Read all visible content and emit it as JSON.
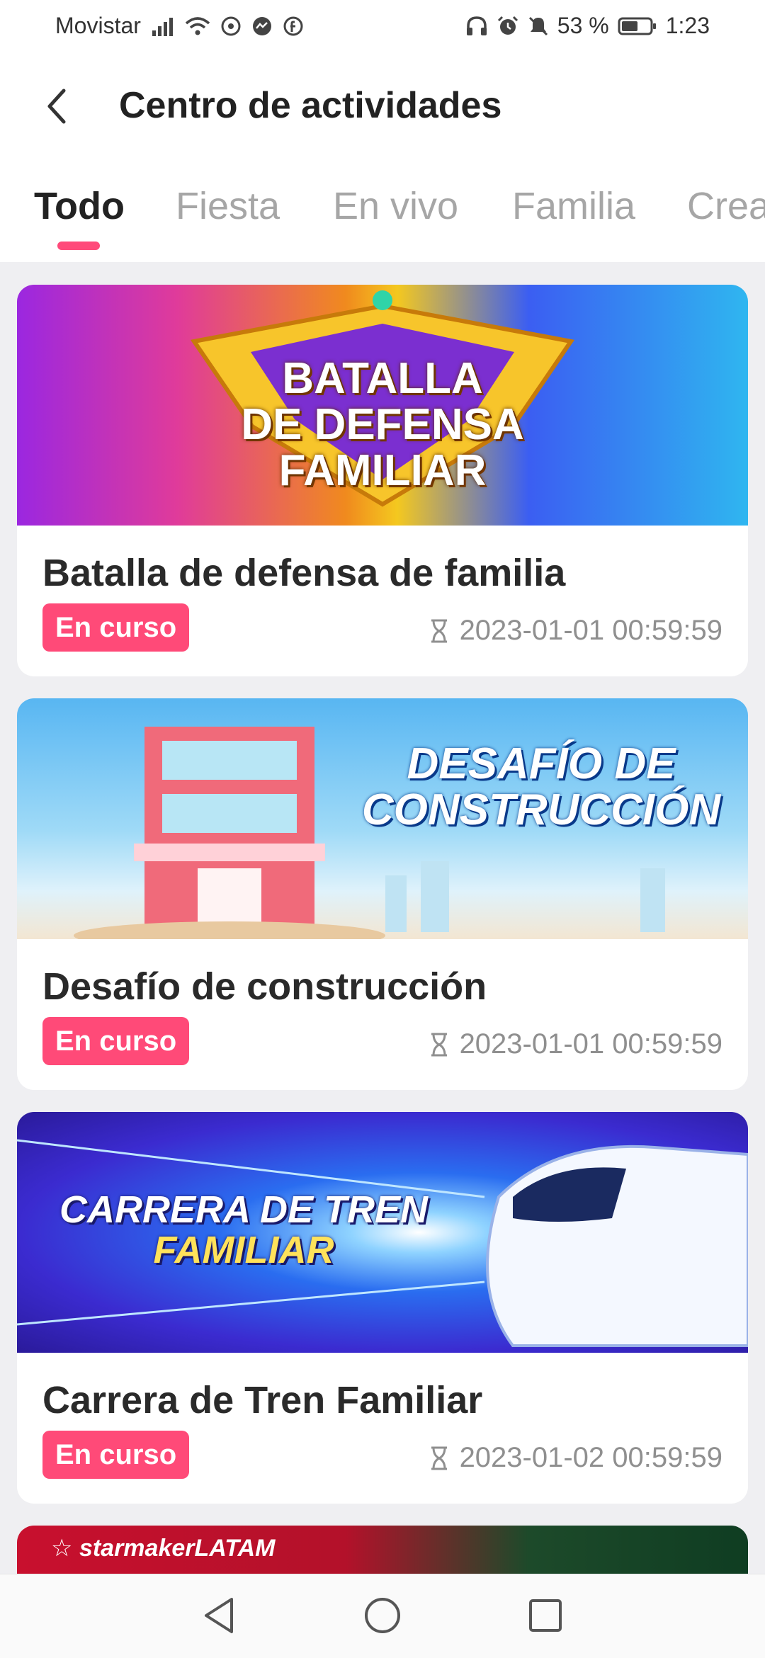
{
  "status_bar": {
    "carrier": "Movistar",
    "battery": "53 %",
    "time": "1:23"
  },
  "header": {
    "title": "Centro de actividades"
  },
  "tabs": [
    {
      "label": "Todo",
      "active": true
    },
    {
      "label": "Fiesta",
      "active": false
    },
    {
      "label": "En vivo",
      "active": false
    },
    {
      "label": "Familia",
      "active": false
    },
    {
      "label": "Crea",
      "active": false
    }
  ],
  "cards": [
    {
      "banner_text": [
        "BATALLA",
        "DE DEFENSA",
        "FAMILIAR"
      ],
      "title": "Batalla de defensa de familia",
      "status": "En curso",
      "time": "2023-01-01 00:59:59"
    },
    {
      "banner_text": [
        "DESAFÍO DE",
        "CONSTRUCCIÓN"
      ],
      "title": "Desafío de construcción",
      "status": "En curso",
      "time": "2023-01-01 00:59:59"
    },
    {
      "banner_text": [
        "CARRERA DE TREN",
        "FAMILIAR"
      ],
      "title": "Carrera de Tren Familiar",
      "status": "En curso",
      "time": "2023-01-02 00:59:59"
    }
  ],
  "partial_card": {
    "brand": "starmakerLATAM"
  },
  "colors": {
    "accent": "#ff4a7a",
    "badge": "#ff4a78"
  }
}
